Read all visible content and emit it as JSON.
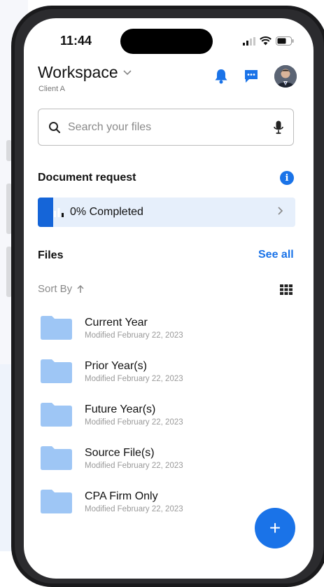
{
  "status_bar": {
    "time": "11:44"
  },
  "header": {
    "title": "Workspace",
    "subtitle": "Client A",
    "icons": [
      "bell-icon",
      "message-icon",
      "avatar"
    ]
  },
  "search": {
    "placeholder": "Search your files",
    "value": ""
  },
  "document_request": {
    "title": "Document request",
    "progress_label": "0% Completed",
    "progress_percent": 0
  },
  "files": {
    "title": "Files",
    "see_all_label": "See all",
    "sort_label": "Sort By",
    "items": [
      {
        "name": "Current Year",
        "modified": "Modified February 22, 2023"
      },
      {
        "name": "Prior Year(s)",
        "modified": "Modified February 22, 2023"
      },
      {
        "name": "Future Year(s)",
        "modified": "Modified February 22, 2023"
      },
      {
        "name": "Source File(s)",
        "modified": "Modified February 22, 2023"
      },
      {
        "name": "CPA Firm Only",
        "modified": "Modified February 22, 2023"
      }
    ]
  },
  "fab": {
    "label": "+"
  },
  "colors": {
    "accent": "#1a73e8",
    "folder": "#9ec6f5",
    "progress_bg": "#e6effb"
  }
}
